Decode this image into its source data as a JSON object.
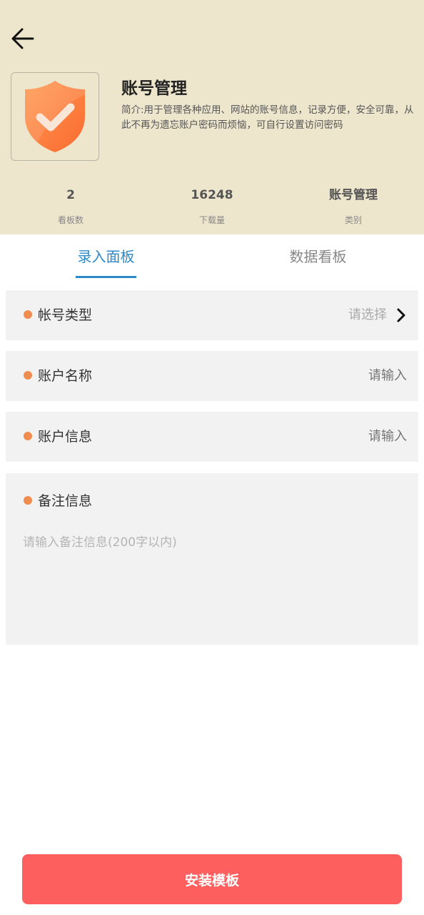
{
  "header": {
    "title": "账号管理",
    "description": "简介:用于管理各种应用、网站的账号信息，记录方便，安全可靠，从此不再为遗忘账户密码而烦恼，可自行设置访问密码",
    "icon": "shield-check-icon",
    "accent_color": "#ede6cd"
  },
  "stats": [
    {
      "value": "2",
      "label": "看板数"
    },
    {
      "value": "16248",
      "label": "下载量"
    },
    {
      "value": "账号管理",
      "label": "类别"
    }
  ],
  "tabs": [
    {
      "label": "录入面板",
      "active": true
    },
    {
      "label": "数据看板",
      "active": false
    }
  ],
  "fields": {
    "account_type": {
      "label": "帐号类型",
      "placeholder": "请选择"
    },
    "account_name": {
      "label": "账户名称",
      "placeholder": "请输入"
    },
    "account_info": {
      "label": "账户信息",
      "placeholder": "请输入"
    },
    "remarks": {
      "label": "备注信息",
      "placeholder": "请输入备注信息(200字以内)"
    }
  },
  "install_button": {
    "label": "安装模板",
    "color": "#fd5f5f"
  },
  "colors": {
    "tab_active": "#2d8ac8",
    "required_dot": "#ef8c4e"
  }
}
